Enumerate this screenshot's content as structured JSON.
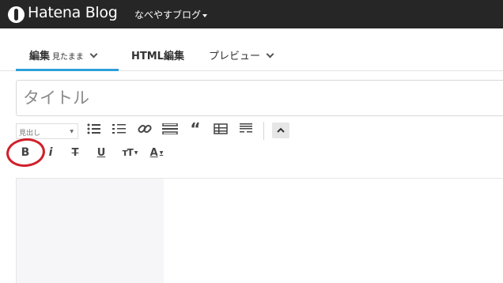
{
  "header": {
    "logo_text": "Hatena Blog",
    "blog_name": "なべやすブログ"
  },
  "tabs": {
    "edit_label": "編集",
    "edit_sub": "見たまま",
    "html_label": "HTML編集",
    "preview_label": "プレビュー",
    "accent_color": "#2d9fd9"
  },
  "title_field": {
    "placeholder": "タイトル",
    "value": ""
  },
  "toolbar": {
    "heading_select": "見出し",
    "icons": [
      "bulleted-list-icon",
      "numbered-list-icon",
      "link-icon",
      "horizontal-rule-icon",
      "blockquote-icon",
      "table-icon",
      "page-break-icon",
      "collapse-toolbar-icon"
    ],
    "bold": "B",
    "italic": "i",
    "strike": "T",
    "underline": "U",
    "font_size": "ᴛT",
    "text_color": "A"
  },
  "annotation": {
    "color": "#d0202a"
  }
}
